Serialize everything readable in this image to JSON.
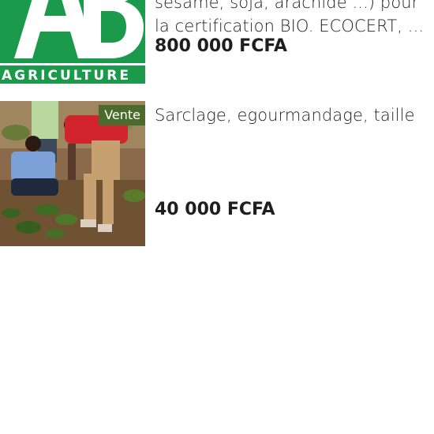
{
  "listings": [
    {
      "thumb_label": "AGRICULTURE",
      "thumb_logo_letters": "AB",
      "desc_line1": "sésame, soja, arachide ...) pour",
      "desc_line2": "la certification BIO. ECOCERT, ...",
      "price": "800 000 FCFA"
    },
    {
      "badge": "Vente",
      "desc_line1": "Sarclage, egourmandage, taille",
      "price": "40 000 FCFA"
    }
  ],
  "colors": {
    "ab_green": "#1a9a4a",
    "badge_green": "#4a6b2b"
  }
}
